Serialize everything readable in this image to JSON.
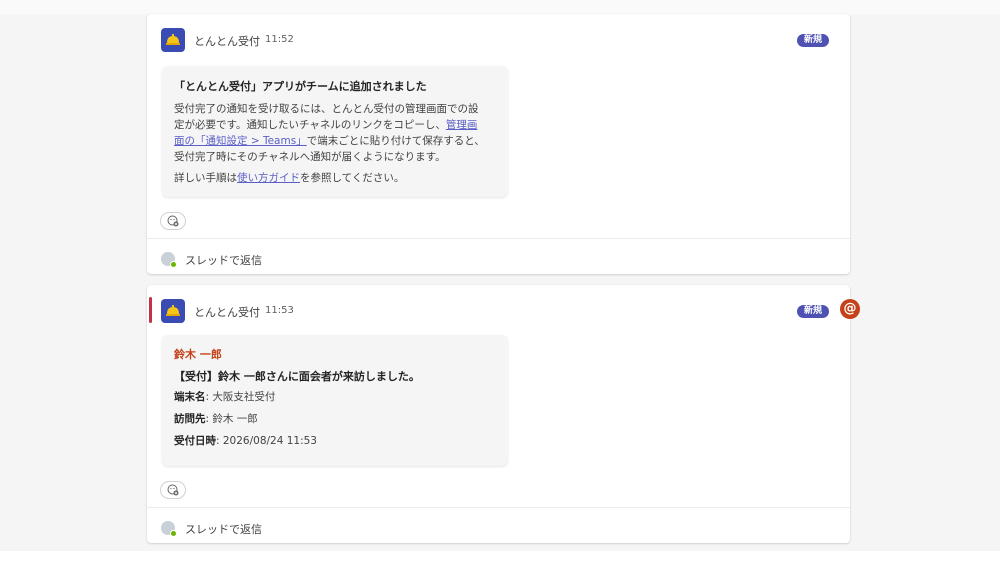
{
  "posts": [
    {
      "sender": "とんとん受付",
      "time": "11:52",
      "badge": "新規",
      "card": {
        "title": "「とんとん受付」アプリがチームに追加されました",
        "body_line1": "受付完了の通知を受け取るには、とんとん受付の管理画面での設",
        "body_line2": "定が必要です。通知したいチャネルのリンクをコピーし、",
        "link1_part1": "管理画",
        "link1_part2": "面の「通知設定 > Teams」",
        "body_line3": "で端末ごとに貼り付けて保存すると、",
        "body_line4": "受付完了時にそのチャネルへ通知が届くようになります。",
        "guide_pre": "詳しい手順は",
        "guide_link": "使い方ガイド",
        "guide_post": "を参照してください。"
      },
      "reply_label": "スレッドで返信"
    },
    {
      "sender": "とんとん受付",
      "time": "11:53",
      "badge": "新規",
      "mention": "@",
      "card": {
        "mention_name": "鈴木 一郎",
        "notice": "【受付】鈴木 一郎さんに面会者が来訪しました。",
        "terminal_label": "端末名",
        "terminal_value": ": 大阪支社受付",
        "visit_label": "訪問先",
        "visit_value": ": 鈴木 一郎",
        "date_label": "受付日時",
        "date_value": ": 2026/08/24 11:53"
      },
      "reply_label": "スレッドで返信"
    }
  ],
  "colors": {
    "avatar_bg": "#3a4cb4",
    "badge_bg": "#4f52b2",
    "mention_red": "#c4411a",
    "link": "#5b5fc7",
    "accent_bar": "#c4314b"
  },
  "icons": {
    "app_avatar": "reception-bell-icon",
    "reaction": "emoji-add-icon",
    "reply_avatar": "user-avatar-icon"
  }
}
